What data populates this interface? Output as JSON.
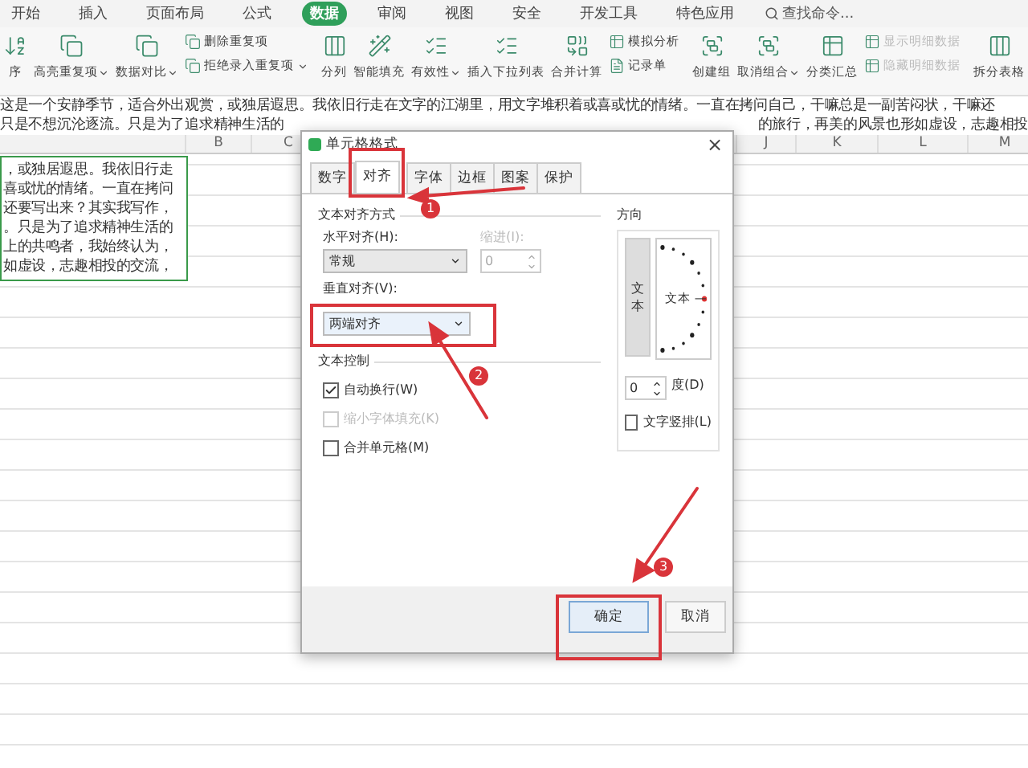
{
  "menu_tabs": [
    {
      "label": "开始",
      "selected": false
    },
    {
      "label": "插入",
      "selected": false
    },
    {
      "label": "页面布局",
      "selected": false
    },
    {
      "label": "公式",
      "selected": false
    },
    {
      "label": "数据",
      "selected": true
    },
    {
      "label": "审阅",
      "selected": false
    },
    {
      "label": "视图",
      "selected": false
    },
    {
      "label": "安全",
      "selected": false
    },
    {
      "label": "开发工具",
      "selected": false
    },
    {
      "label": "特色应用",
      "selected": false
    }
  ],
  "search": {
    "placeholder": "查找命令..."
  },
  "ribbon": [
    {
      "kind": "large",
      "label": "序",
      "dropdown": false
    },
    {
      "kind": "large",
      "label": "高亮重复项",
      "dropdown": true
    },
    {
      "kind": "large",
      "label": "数据对比",
      "dropdown": true
    },
    {
      "kind": "stack",
      "items": [
        {
          "label": "删除重复项",
          "dropdown": false,
          "disabled": false
        },
        {
          "label": "拒绝录入重复项",
          "dropdown": true,
          "disabled": false
        }
      ]
    },
    {
      "kind": "separator"
    },
    {
      "kind": "large",
      "label": "分列",
      "dropdown": false
    },
    {
      "kind": "large",
      "label": "智能填充",
      "dropdown": false
    },
    {
      "kind": "large",
      "label": "有效性",
      "dropdown": true
    },
    {
      "kind": "large",
      "label": "插入下拉列表",
      "dropdown": false
    },
    {
      "kind": "large",
      "label": "合并计算",
      "dropdown": false
    },
    {
      "kind": "stack",
      "items": [
        {
          "label": "模拟分析",
          "dropdown": false,
          "disabled": false
        },
        {
          "label": "记录单",
          "dropdown": false,
          "disabled": false
        }
      ]
    },
    {
      "kind": "separator"
    },
    {
      "kind": "large",
      "label": "创建组",
      "dropdown": false
    },
    {
      "kind": "large",
      "label": "取消组合",
      "dropdown": true
    },
    {
      "kind": "large",
      "label": "分类汇总",
      "dropdown": false
    },
    {
      "kind": "stack",
      "items": [
        {
          "label": "显示明细数据",
          "dropdown": false,
          "disabled": true
        },
        {
          "label": "隐藏明细数据",
          "dropdown": false,
          "disabled": true
        }
      ]
    },
    {
      "kind": "separator"
    },
    {
      "kind": "large",
      "label": "拆分表格",
      "dropdown": false
    }
  ],
  "formula_text": {
    "line_1": "这是一个安静季节，适合外出观赏，或独居遐思。我依旧行走在文字的江湖里，用文字堆积着或喜或忧的情绪。一直在拷问自己，干嘛总是一副苦闷状，干嘛还",
    "line_2_left": "只是不想沉沦逐流。只是为了追求精神生活的",
    "line_2_right": "的旅行，再美的风景也形如虚设，志趣相投"
  },
  "columns": [
    "B",
    "C",
    "J",
    "K",
    "L",
    "M"
  ],
  "cell_text": [
    "，或独居遐思。我依旧行走",
    "喜或忧的情绪。一直在拷问",
    "还要写出来？其实我写作，",
    "。只是为了追求精神生活的",
    "上的共鸣者，我始终认为，",
    "如虚设，志趣相投的交流，"
  ],
  "dialog": {
    "title": "单元格格式",
    "close": "×",
    "tabs": [
      {
        "label": "数字",
        "selected": false
      },
      {
        "label": "对齐",
        "selected": true
      },
      {
        "label": "字体",
        "selected": false
      },
      {
        "label": "边框",
        "selected": false
      },
      {
        "label": "图案",
        "selected": false
      },
      {
        "label": "保护",
        "selected": false
      }
    ],
    "alignment_section": "文本对齐方式",
    "horizontal_label": "水平对齐(H):",
    "horizontal_value": "常规",
    "indent_label": "缩进(I):",
    "indent_value": "0",
    "indent_disabled": true,
    "vertical_label": "垂直对齐(V):",
    "vertical_value": "两端对齐",
    "control_section": "文本控制",
    "checkboxes": [
      {
        "label": "自动换行(W)",
        "checked": true,
        "disabled": false
      },
      {
        "label": "缩小字体填充(K)",
        "checked": false,
        "disabled": true
      },
      {
        "label": "合并单元格(M)",
        "checked": false,
        "disabled": false
      }
    ],
    "orientation": {
      "title": "方向",
      "vertical_text": "文本",
      "dial_label": "文本 —",
      "degrees": "0",
      "degrees_label": "度(D)",
      "vertical_checkbox": {
        "label": "文字竖排(L)",
        "checked": false
      }
    },
    "buttons": [
      {
        "label": "确定",
        "kind": "primary"
      },
      {
        "label": "取消",
        "kind": "secondary"
      }
    ]
  },
  "step_badges": [
    "1",
    "2",
    "3"
  ]
}
